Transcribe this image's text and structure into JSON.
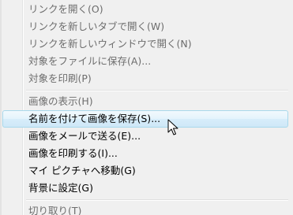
{
  "context_menu": {
    "items": [
      {
        "label": "リンクを開く(O)",
        "enabled": false
      },
      {
        "label": "リンクを新しいタブで開く(W)",
        "enabled": false
      },
      {
        "label": "リンクを新しいウィンドウで開く(N)",
        "enabled": false
      },
      {
        "label": "対象をファイルに保存(A)...",
        "enabled": false
      },
      {
        "label": "対象を印刷(P)",
        "enabled": false
      },
      {
        "label": "画像の表示(H)",
        "enabled": false
      },
      {
        "label": "名前を付けて画像を保存(S)...",
        "enabled": true,
        "hovered": true
      },
      {
        "label": "画像をメールで送る(E)...",
        "enabled": true
      },
      {
        "label": "画像を印刷する(I)...",
        "enabled": true
      },
      {
        "label": "マイ ピクチャへ移動(G)",
        "enabled": true
      },
      {
        "label": "背景に設定(G)",
        "enabled": true
      },
      {
        "label": "切り取り(T)",
        "enabled": false
      }
    ]
  },
  "colors": {
    "menu_background": "#f0f0f0",
    "disabled_text": "#6d6d6d",
    "enabled_text": "#000000",
    "hover_border": "#a8d8eb",
    "hover_fill": "#dcf0fb"
  },
  "cursor_icon": "arrow-pointer"
}
